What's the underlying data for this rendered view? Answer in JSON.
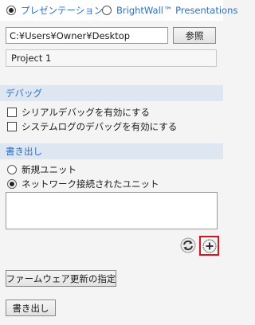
{
  "tabs": [
    {
      "label": "プレゼンテーション",
      "selected": true
    },
    {
      "label": "BrightWall™ Presentations",
      "selected": false
    }
  ],
  "path": {
    "value": "C:¥Users¥Owner¥Desktop",
    "browse_label": "参照"
  },
  "project_name": "Project 1",
  "debug": {
    "header": "デバッグ",
    "options": [
      {
        "label": "シリアルデバッグを有効にする",
        "checked": false
      },
      {
        "label": "システムログのデバッグを有効にする",
        "checked": false
      }
    ]
  },
  "publish": {
    "header": "書き出し",
    "options": [
      {
        "label": "新規ユニット",
        "selected": false
      },
      {
        "label": "ネットワーク接続されたユニット",
        "selected": true
      }
    ]
  },
  "icons": {
    "refresh": "refresh-icon",
    "add": "plus-circle-icon"
  },
  "buttons": {
    "firmware": "ファームウェア更新の指定",
    "export": "書き出し"
  },
  "colors": {
    "accent": "#2b6fc6",
    "section_bg": "#dde6f1",
    "highlight": "#d9141e"
  }
}
